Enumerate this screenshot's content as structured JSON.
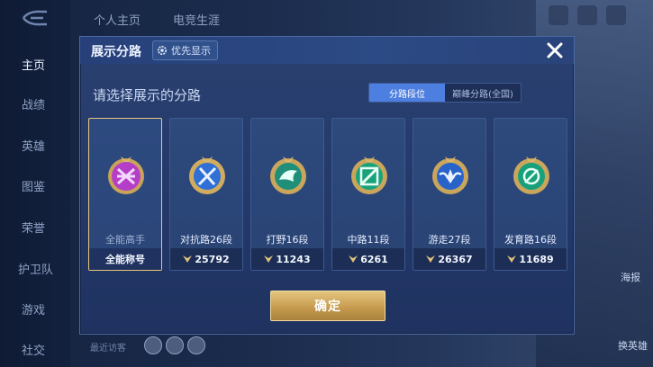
{
  "colors": {
    "accent_gold": "#e9c77a",
    "tab_active": "#4d7fe0",
    "confirm_gold": "#c79c4f"
  },
  "top_tabs": [
    "个人主页",
    "电竞生涯"
  ],
  "sidebar": {
    "items": [
      {
        "label": "主页",
        "active": true
      },
      {
        "label": "战绩"
      },
      {
        "label": "英雄"
      },
      {
        "label": "图鉴"
      },
      {
        "label": "荣誉"
      },
      {
        "label": "护卫队"
      },
      {
        "label": "游戏"
      },
      {
        "label": "社交"
      }
    ]
  },
  "footer": {
    "visitors_label": "最近访客",
    "poster_label": "海报",
    "swap_label": "换英雄"
  },
  "modal": {
    "title": "展示分路",
    "priority_label": "优先显示",
    "prompt": "请选择展示的分路",
    "tabs": [
      {
        "label": "分路段位",
        "active": true
      },
      {
        "label": "巅峰分路(全国)",
        "active": false
      }
    ],
    "cards": [
      {
        "name": "全能高手",
        "footer": "全能称号",
        "emblem": "purple-emblem-icon",
        "selected": true
      },
      {
        "name": "对抗路26段",
        "points": "25792",
        "emblem": "sword-emblem-icon"
      },
      {
        "name": "打野16段",
        "points": "11243",
        "emblem": "dragon-emblem-icon"
      },
      {
        "name": "中路11段",
        "points": "6261",
        "emblem": "wand-emblem-icon"
      },
      {
        "name": "游走27段",
        "points": "26367",
        "emblem": "wing-emblem-icon"
      },
      {
        "name": "发育路16段",
        "points": "11689",
        "emblem": "target-emblem-icon"
      }
    ],
    "confirm_label": "确定"
  }
}
